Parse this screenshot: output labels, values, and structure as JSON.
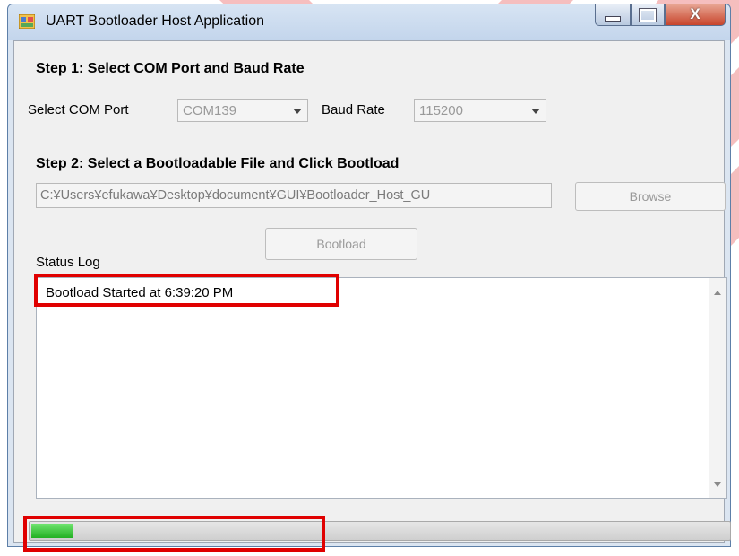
{
  "window": {
    "title": "UART Bootloader Host Application"
  },
  "step1": {
    "heading": "Step 1: Select COM Port and Baud Rate",
    "com_label": "Select COM Port",
    "com_value": "COM139",
    "baud_label": "Baud Rate",
    "baud_value": "115200"
  },
  "step2": {
    "heading": "Step 2: Select a Bootloadable File and Click Bootload",
    "file_path": "C:¥Users¥efukawa¥Desktop¥document¥GUI¥Bootloader_Host_GU",
    "browse_label": "Browse",
    "bootload_label": "Bootload"
  },
  "status": {
    "label": "Status Log",
    "lines": [
      "Bootload Started at 6:39:20 PM"
    ]
  },
  "progress": {
    "fraction": 0.06
  },
  "colors": {
    "highlight": "#e00000",
    "progress_fill": "#23b023",
    "decor_stripes": "#f5b5b5"
  },
  "icons": {
    "app": "app-window-icon",
    "minimize": "minimize-icon",
    "maximize": "maximize-icon",
    "close": "close-icon"
  }
}
